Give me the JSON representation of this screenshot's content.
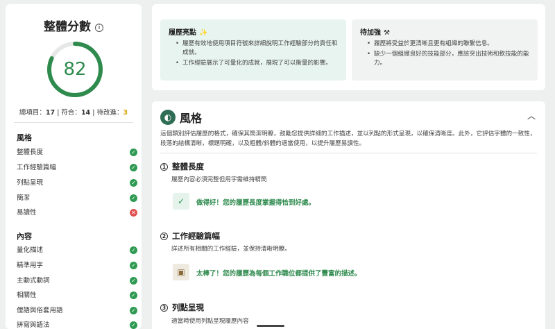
{
  "sidebar": {
    "score_title": "整體分數",
    "score": "82",
    "score_fraction": 0.82,
    "stats": {
      "total_label": "總項目：",
      "total": "17",
      "pass_label": "符合：",
      "pass": "14",
      "fix_label": "待改進：",
      "fix": "3"
    },
    "sections": [
      {
        "title": "風格",
        "items": [
          {
            "label": "整體長度",
            "ok": true
          },
          {
            "label": "工作經驗篇幅",
            "ok": true
          },
          {
            "label": "列點呈現",
            "ok": true
          },
          {
            "label": "簡潔",
            "ok": true
          },
          {
            "label": "易讀性",
            "ok": false
          }
        ]
      },
      {
        "title": "內容",
        "items": [
          {
            "label": "量化描述",
            "ok": true
          },
          {
            "label": "精準用字",
            "ok": true
          },
          {
            "label": "主動式動詞",
            "ok": true
          },
          {
            "label": "相關性",
            "ok": true
          },
          {
            "label": "俚語與俗套用語",
            "ok": true
          },
          {
            "label": "拼寫與語法",
            "ok": true
          }
        ]
      }
    ]
  },
  "highlights": {
    "title": "履歷亮點",
    "icon": "sparkle-icon",
    "items": [
      "履歷有效地使用項目符號來詳細說明工作經驗部分的責任和成就。",
      "工作經驗展示了可量化的成就，展現了可以衡量的影響。"
    ]
  },
  "improve": {
    "title": "待加強",
    "icon": "tools-icon",
    "items": [
      "履歷將受益於更清晰且更有組織的聯繫信息。",
      "缺少一個組織良好的技能部分，應該突出技術和軟技能的能力。"
    ]
  },
  "style": {
    "title": "風格",
    "icon": "palette-icon",
    "description": "這個類別評估履歷的格式，確保其簡潔明瞭，鼓勵您提供詳細的工作描述，並以列點的形式呈現，以確保清晰度。此外，它評估字體的一致性，段落的結構清晰，標題明確，以及粗體/斜體的適當使用，以提升履歷易讀性。",
    "subs": [
      {
        "num": "1",
        "title": "整體長度",
        "desc": "履歷內容必須完整但用字需維持精簡",
        "feedback": "做得好！您的履歷長度掌握得恰到好處。"
      },
      {
        "num": "2",
        "title": "工作經驗篇幅",
        "desc": "詳述所有相關的工作經驗，並保持清晰明瞭。",
        "feedback": "太棒了！您的履歷為每個工作職位都提供了豐富的描述。"
      },
      {
        "num": "3",
        "title": "列點呈現",
        "desc": "適當時使用列點呈現履歷內容"
      }
    ]
  },
  "colors": {
    "accent": "#2e8a4d",
    "check": "#2e9a52",
    "error": "#e05252",
    "warn": "#d9a400"
  }
}
